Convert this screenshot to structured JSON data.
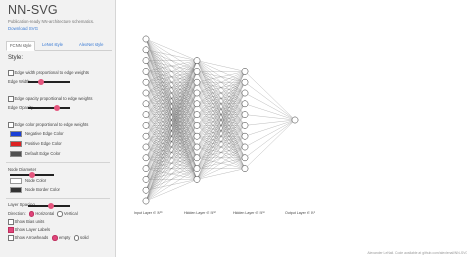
{
  "app": {
    "name": "NN-SVG",
    "tagline": "Publication-ready NN-architecture schematics.",
    "download": "Download SVG"
  },
  "tabs": [
    {
      "label": "FCNN style"
    },
    {
      "label": "LeNet style"
    },
    {
      "label": "AlexNet style"
    }
  ],
  "style_heading": "Style:",
  "controls": {
    "edge_width_prop": "Edge width proportional to edge weights",
    "edge_width_label": "Edge Width",
    "edge_width_value": 0.3,
    "edge_opacity_prop": "Edge opacity proportional to edge weights",
    "edge_opacity_label": "Edge Opacity",
    "edge_opacity_value": 0.7,
    "edge_color_prop": "Edge color proportional to edge weights",
    "negative_edge_color_label": "Negative Edge Color",
    "negative_edge_color": "#1a3fd6",
    "positive_edge_color_label": "Positive Edge Color",
    "positive_edge_color": "#dd2222",
    "default_edge_color_label": "Default Edge Color",
    "default_edge_color": "#505050",
    "node_diameter_label": "Node Diameter",
    "node_diameter_value": 0.5,
    "node_color_label": "Node Color",
    "node_color": "#ffffff",
    "node_border_color_label": "Node Border Color",
    "node_border_color": "#333333",
    "layer_spacing_label": "Layer Spacing",
    "layer_spacing_value": 0.55,
    "direction_label": "Direction:",
    "direction_options": [
      "Horizontal",
      "Vertical"
    ],
    "direction_selected": "Horizontal",
    "show_bias_label": "Show Bias units",
    "show_layer_labels_label": "Show Layer Labels",
    "show_arrowheads_label": "Show Arrowheads",
    "arrowhead_options": [
      "empty",
      "solid"
    ],
    "arrowhead_selected": "empty"
  },
  "network": {
    "layer_sizes": [
      16,
      12,
      10,
      1
    ],
    "labels": [
      "Input Layer ∈ ℝ¹⁶",
      "Hidden Layer ∈ ℝ¹²",
      "Hidden Layer ∈ ℝ¹⁰",
      "Output Layer ∈ ℝ¹"
    ]
  },
  "footer": "Alexander LeNail. Code available at github.com/alexlenail/NN-SVG"
}
